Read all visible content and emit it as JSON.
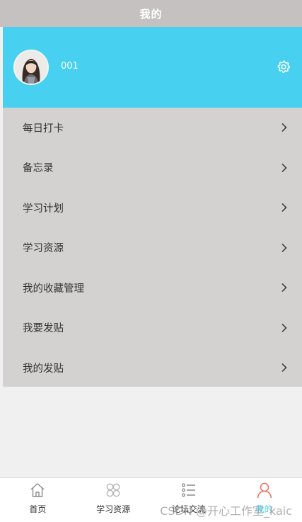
{
  "header": {
    "title": "我的"
  },
  "profile": {
    "username": "001",
    "avatar_icon": "user-avatar-photo",
    "settings_icon": "gear-icon"
  },
  "menu": {
    "items": [
      {
        "label": "每日打卡"
      },
      {
        "label": "备忘录"
      },
      {
        "label": "学习计划"
      },
      {
        "label": "学习资源"
      },
      {
        "label": "我的收藏管理"
      },
      {
        "label": "我要发贴"
      },
      {
        "label": "我的发贴"
      }
    ]
  },
  "tabbar": {
    "tabs": [
      {
        "label": "首页",
        "icon": "home-icon"
      },
      {
        "label": "学习资源",
        "icon": "grid-icon"
      },
      {
        "label": "论坛交流",
        "icon": "list-icon"
      },
      {
        "label": "我的",
        "icon": "person-icon",
        "active": true
      }
    ]
  },
  "watermark": {
    "text": "CSDN @开心工作室_kaic"
  },
  "colors": {
    "header_bg": "#c5c1c1",
    "profile_bg": "#47d0ef",
    "menu_bg": "#d3d2d1",
    "active_tab_icon": "#e8705c",
    "active_tab_label": "#47d0ef"
  }
}
